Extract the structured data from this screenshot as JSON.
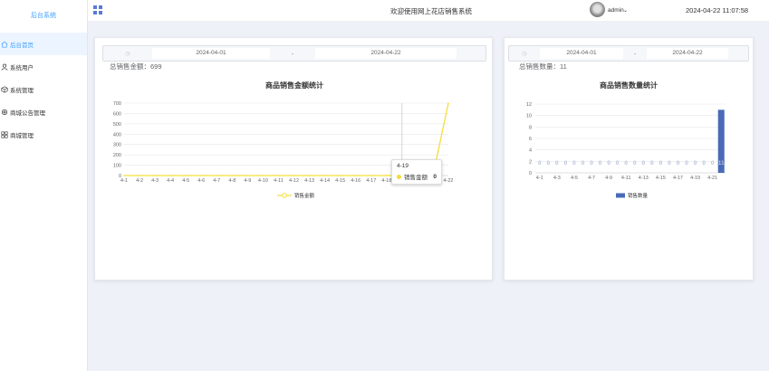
{
  "sidebar": {
    "title": "后台系统",
    "items": [
      {
        "label": "后台首页",
        "icon": "home-icon",
        "active": true
      },
      {
        "label": "系统用户",
        "icon": "user-icon",
        "active": false
      },
      {
        "label": "系统管理",
        "icon": "box-icon",
        "active": false
      },
      {
        "label": "商城公告管理",
        "icon": "gear-icon",
        "active": false
      },
      {
        "label": "商城管理",
        "icon": "grid-icon",
        "active": false
      }
    ]
  },
  "header": {
    "title": "欢迎使用网上花店销售系统",
    "username": "admin",
    "datetime": "2024-04-22 11:07:58"
  },
  "left_card": {
    "start_date": "2024-04-01",
    "separator": "-",
    "end_date": "2024-04-22",
    "total_label": "总销售金额：699",
    "tooltip": {
      "date": "4-19",
      "series": "销售金额",
      "value": "0"
    }
  },
  "right_card": {
    "start_date": "2024-04-01",
    "separator": "-",
    "end_date": "2024-04-22",
    "total_label": "总销售数量：11"
  },
  "colors": {
    "accent": "#409eff",
    "line": "#f5dd3a",
    "bar": "#4a6ab8"
  },
  "chart_data": [
    {
      "type": "line",
      "title": "商品销售金额统计",
      "categories": [
        "4-1",
        "4-2",
        "4-3",
        "4-4",
        "4-5",
        "4-6",
        "4-7",
        "4-8",
        "4-9",
        "4-10",
        "4-11",
        "4-12",
        "4-13",
        "4-14",
        "4-15",
        "4-16",
        "4-17",
        "4-18",
        "4-19",
        "4-20",
        "4-21",
        "4-22"
      ],
      "series": [
        {
          "name": "销售金额",
          "values": [
            0,
            0,
            0,
            0,
            0,
            0,
            0,
            0,
            0,
            0,
            0,
            0,
            0,
            0,
            0,
            0,
            0,
            0,
            0,
            0,
            0,
            699
          ]
        }
      ],
      "ylim": [
        0,
        700
      ],
      "yticks": [
        0,
        100,
        200,
        300,
        400,
        500,
        600,
        700
      ],
      "xticks": [
        "4-1",
        "4-2",
        "4-3",
        "4-4",
        "4-5",
        "4-6",
        "4-7",
        "4-8",
        "4-9",
        "4-10",
        "4-11",
        "4-12",
        "4-13",
        "4-14",
        "4-15",
        "4-16",
        "4-17",
        "4-18",
        "4-22"
      ],
      "legend": "bottom-center",
      "grid": true
    },
    {
      "type": "bar",
      "title": "商品销售数量统计",
      "categories": [
        "4-1",
        "4-2",
        "4-3",
        "4-4",
        "4-5",
        "4-6",
        "4-7",
        "4-8",
        "4-9",
        "4-10",
        "4-11",
        "4-12",
        "4-13",
        "4-14",
        "4-15",
        "4-16",
        "4-17",
        "4-18",
        "4-19",
        "4-20",
        "4-21",
        "4-22"
      ],
      "series": [
        {
          "name": "销售数量",
          "values": [
            0,
            0,
            0,
            0,
            0,
            0,
            0,
            0,
            0,
            0,
            0,
            0,
            0,
            0,
            0,
            0,
            0,
            0,
            0,
            0,
            0,
            11
          ]
        }
      ],
      "data_labels": [
        "0",
        "0",
        "0",
        "0",
        "0",
        "0",
        "0",
        "0",
        "0",
        "0",
        "0",
        "0",
        "0",
        "0",
        "0",
        "0",
        "0",
        "0",
        "0",
        "0",
        "0",
        "11"
      ],
      "ylim": [
        0,
        12
      ],
      "yticks": [
        0,
        2,
        4,
        6,
        8,
        10,
        12
      ],
      "xticks": [
        "4-1",
        "4-3",
        "4-5",
        "4-7",
        "4-9",
        "4-11",
        "4-13",
        "4-15",
        "4-17",
        "4-19",
        "4-21"
      ],
      "legend": "bottom-center",
      "grid": true
    }
  ]
}
